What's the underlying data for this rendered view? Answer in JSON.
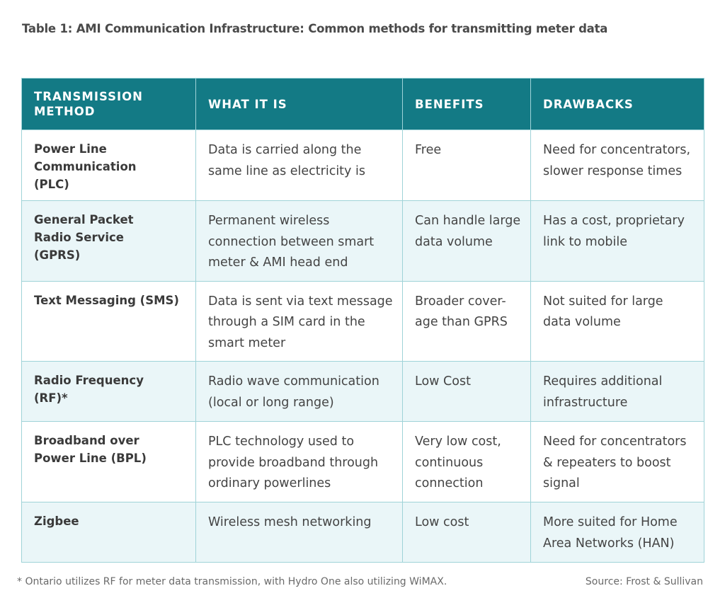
{
  "title": "Table 1: AMI Communication Infrastructure: Common methods for transmitting meter data",
  "colors": {
    "header_bg": "#137a85",
    "header_text": "#ffffff",
    "alt_row_bg": "#eaf6f8",
    "border": "#9fd3d8"
  },
  "table": {
    "headers": [
      "TRANSMISSION METHOD",
      "WHAT IT IS",
      "BENEFITS",
      "DRAWBACKS"
    ],
    "rows": [
      {
        "method": "Power Line Communication (PLC)",
        "what": "Data is carried along the same line as electricity is",
        "benefits": "Free",
        "drawbacks": "Need for concentrators, slower response times"
      },
      {
        "method": "General Packet Radio Service (GPRS)",
        "what": "Permanent wireless connection between smart meter & AMI head end",
        "benefits": "Can handle large data volume",
        "drawbacks": "Has a cost, proprietary link to mobile"
      },
      {
        "method": "Text Messaging (SMS)",
        "what": "Data is sent via text message through a SIM card in the smart meter",
        "benefits": "Broader cover-age than GPRS",
        "drawbacks": "Not suited for large data volume"
      },
      {
        "method": "Radio Frequency (RF)*",
        "what": "Radio wave communication (local or long range)",
        "benefits": "Low Cost",
        "drawbacks": "Requires additional infrastructure"
      },
      {
        "method": "Broadband over Power Line (BPL)",
        "what": "PLC technology used to provide broadband through ordinary powerlines",
        "benefits": "Very low cost, continuous connection",
        "drawbacks": "Need for concentrators & repeaters to boost signal"
      },
      {
        "method": "Zigbee",
        "what": "Wireless mesh networking",
        "benefits": "Low cost",
        "drawbacks": "More suited for Home Area Networks (HAN)"
      }
    ]
  },
  "footnote": "* Ontario utilizes RF for meter data transmission, with Hydro One also utilizing WiMAX.",
  "source": "Source: Frost & Sullivan"
}
